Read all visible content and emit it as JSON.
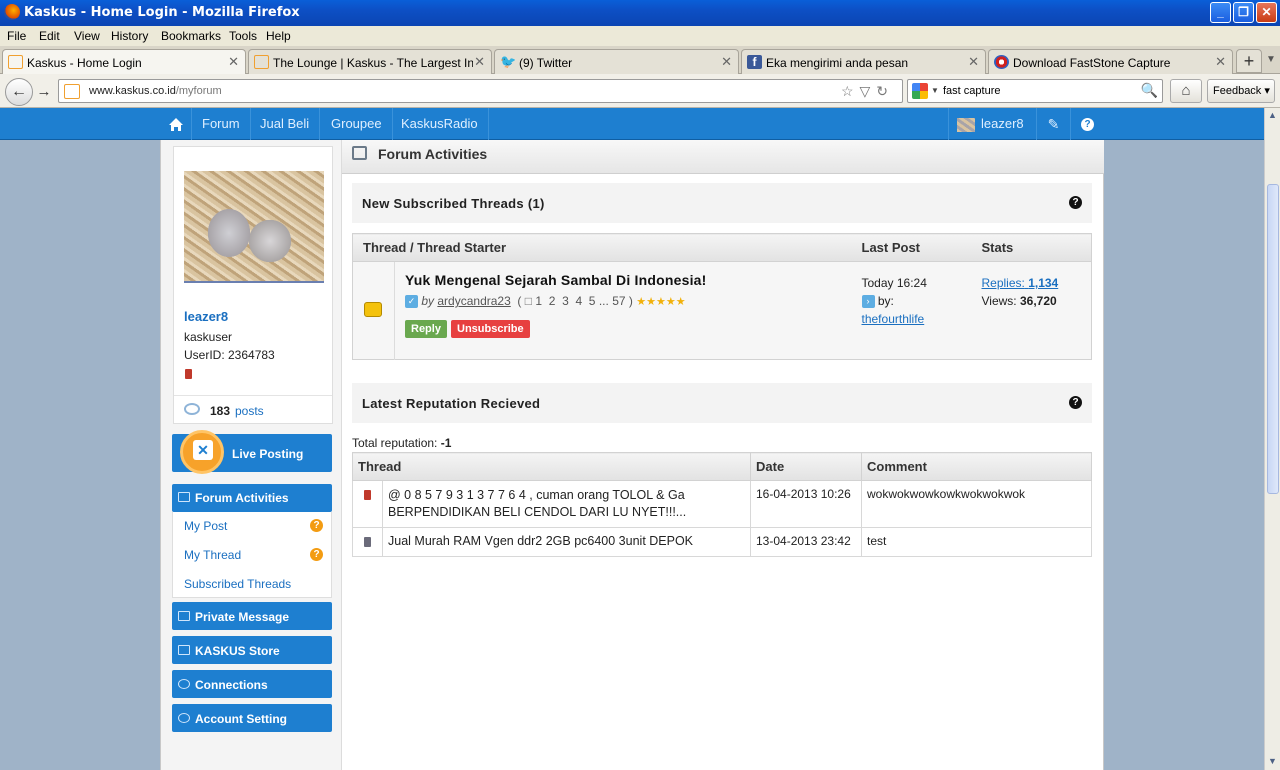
{
  "window": {
    "title": "Kaskus - Home Login - Mozilla Firefox"
  },
  "menu": [
    "File",
    "Edit",
    "View",
    "History",
    "Bookmarks",
    "Tools",
    "Help"
  ],
  "tabs": [
    {
      "label": "Kaskus - Home Login",
      "icon": "kaskus-icon"
    },
    {
      "label": "The Lounge | Kaskus - The Largest Indo...",
      "icon": "kaskus-icon"
    },
    {
      "label": "(9) Twitter",
      "icon": "twitter-icon"
    },
    {
      "label": "Eka mengirimi anda pesan",
      "icon": "facebook-icon"
    },
    {
      "label": "Download FastStone Capture",
      "icon": "faststone-icon"
    }
  ],
  "nav": {
    "url_host": "www.kaskus.co.id",
    "url_path": "/myforum",
    "search_value": "fast capture",
    "feedback_label": "Feedback"
  },
  "site_nav": {
    "items": [
      "Forum",
      "Jual Beli",
      "Groupee",
      "KaskusRadio"
    ],
    "username": "leazer8"
  },
  "profile": {
    "username": "leazer8",
    "rank": "kaskuser",
    "user_id": "UserID: 2364783",
    "posts_count": "183",
    "posts_label": "posts"
  },
  "sidebar": {
    "live_posting": "Live Posting",
    "forum_activities": "Forum Activities",
    "sub_items": [
      "My Post",
      "My Thread",
      "Subscribed Threads"
    ],
    "private_message": "Private Message",
    "store": "KASKUS Store",
    "connections": "Connections",
    "account_setting": "Account Setting"
  },
  "main": {
    "header": "Forum Activities",
    "subscribed": {
      "title": "New Subscribed Threads (1)",
      "columns": [
        "Thread / Thread Starter",
        "Last Post",
        "Stats"
      ],
      "thread": {
        "title": "Yuk Mengenal Sejarah Sambal Di Indonesia!",
        "by_label": "by",
        "starter": "ardycandra23",
        "pages": [
          "1",
          "2",
          "3",
          "4",
          "5",
          "...",
          "57"
        ],
        "rating": 5,
        "reply_label": "Reply",
        "unsubscribe_label": "Unsubscribe",
        "last_post_time": "Today 16:24",
        "last_post_by_label": "by:",
        "last_post_user": "thefourthlife",
        "replies_label": "Replies:",
        "replies": "1,134",
        "views_label": "Views:",
        "views": "36,720"
      }
    },
    "reputation": {
      "title": "Latest Reputation Recieved",
      "total_label": "Total reputation:",
      "total_value": "-1",
      "columns": [
        "Thread",
        "Date",
        "Comment"
      ],
      "rows": [
        {
          "status_color": "#c0392b",
          "thread": "@ 0 8 5 7  9 3 1 3  7 7 6 4 , cuman orang TOLOL & Ga BERPENDIDIKAN BELI CENDOL DARI LU NYET!!!...",
          "date": "16-04-2013 10:26",
          "comment": "wokwokwowkowkwokwokwok"
        },
        {
          "status_color": "#6b6b7a",
          "thread": "Jual Murah RAM Vgen ddr2 2GB pc6400 3unit DEPOK",
          "date": "13-04-2013 23:42",
          "comment": "test"
        }
      ]
    }
  }
}
